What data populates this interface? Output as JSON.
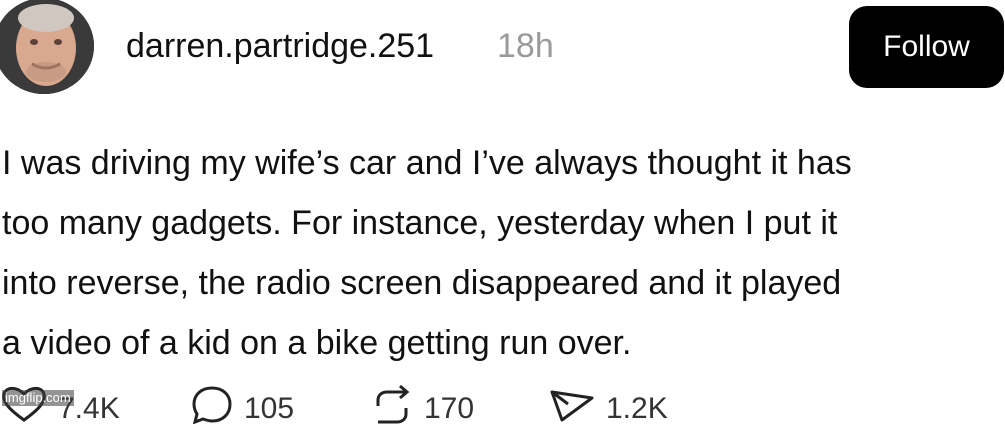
{
  "post": {
    "username": "darren.partridge.251",
    "time": "18h",
    "follow_label": "Follow",
    "lines": [
      "I was driving my wife’s car and I’ve always thought it has",
      "too many gadgets. For instance, yesterday when I put it",
      "into reverse, the radio screen disappeared and it played",
      "a video of a kid on a bike getting run over."
    ]
  },
  "actions": {
    "likes": "7.4K",
    "comments": "105",
    "reposts": "170",
    "shares": "1.2K"
  },
  "watermark": "imgflip.com"
}
